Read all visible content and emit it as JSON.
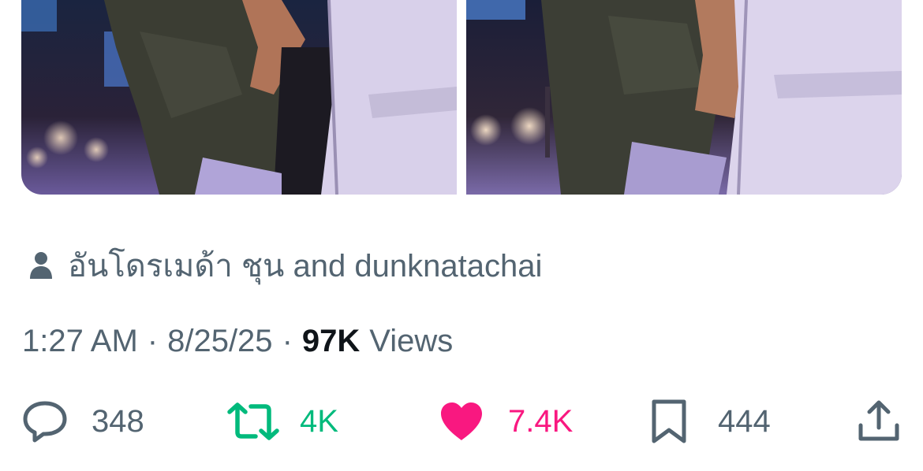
{
  "media": {
    "photos": [
      {
        "name": "photo-1",
        "icon": "photo"
      },
      {
        "name": "photo-2",
        "icon": "photo"
      }
    ]
  },
  "tagged": {
    "icon": "person-icon",
    "text": "อันโดรเมด้า ชุน and dunknatachai"
  },
  "meta": {
    "time": "1:27 AM",
    "separator": "·",
    "date": "8/25/25",
    "views_count": "97K",
    "views_label": "Views"
  },
  "actions": {
    "reply": {
      "icon": "reply-icon",
      "count": "348"
    },
    "retweet": {
      "icon": "retweet-icon",
      "count": "4K",
      "color": "#00ba7c"
    },
    "like": {
      "icon": "heart-icon",
      "count": "7.4K",
      "color": "#f91880"
    },
    "bookmark": {
      "icon": "bookmark-icon",
      "count": "444"
    },
    "share": {
      "icon": "share-icon"
    }
  },
  "colors": {
    "secondary_text": "#536471",
    "primary_text": "#0f1419",
    "retweet_green": "#00ba7c",
    "like_pink": "#f91880"
  }
}
